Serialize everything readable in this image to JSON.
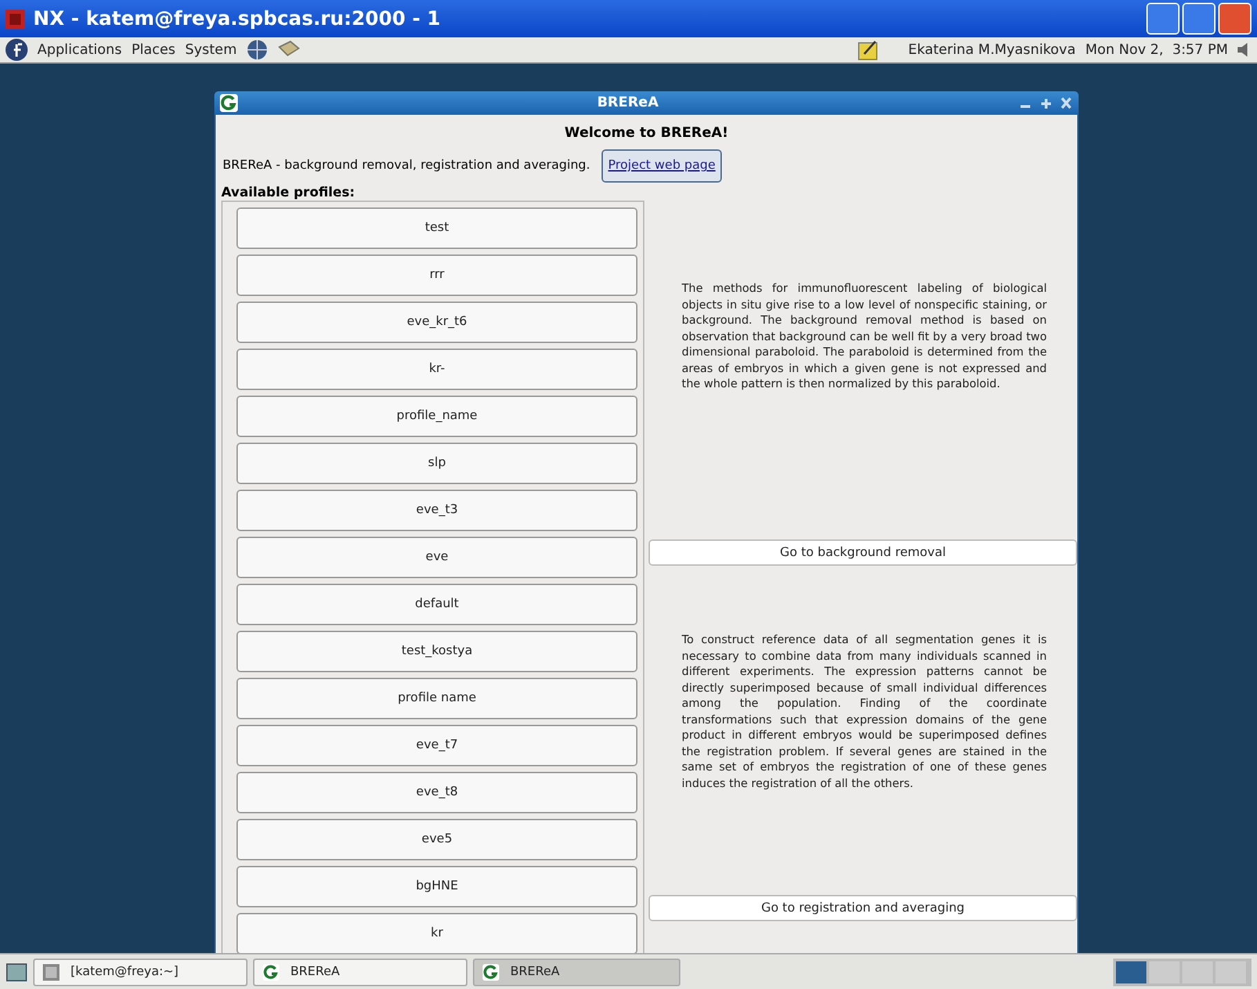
{
  "nx_window": {
    "title": "NX - katem@freya.spbcas.ru:2000 - 1"
  },
  "panel": {
    "menus": [
      "Applications",
      "Places",
      "System"
    ],
    "user": "Ekaterina M.Myasnikova",
    "clock": "Mon Nov 2,  3:57 PM"
  },
  "app_window": {
    "title": "BREReA",
    "heading": "Welcome to BREReA!",
    "description": "BREReA - background removal, registration and averaging.",
    "link": "Project web page",
    "profiles_label": "Available profiles:",
    "profiles": [
      "test",
      "rrr",
      "eve_kr_t6",
      "kr-",
      "profile_name",
      "slp",
      "eve_t3",
      "eve",
      "default",
      "test_kostya",
      "profile name",
      "eve_t7",
      "eve_t8",
      "eve5",
      "bgHNE",
      "kr"
    ],
    "sections": [
      {
        "text": "The methods for immunofluorescent labeling of biological objects in situ give rise to a low level of nonspecific staining, or background. The background removal method is based on observation that background can be well fit by a very broad two dimensional paraboloid. The paraboloid is determined from the areas of embryos in which a given gene is not expressed and the whole pattern is then normalized by this paraboloid.",
        "button": "Go to background removal"
      },
      {
        "text": "To construct reference data of all segmentation genes it is necessary to combine data from many individuals scanned in different experiments. The expression patterns cannot be directly superimposed because of small individual differences among the population. Finding of the coordinate transformations such that expression domains of the gene product in different embryos would be superimposed defines the registration problem. If several genes are stained in the same set of embryos the registration of one of these genes induces the registration of all the others.",
        "button": "Go to registration and averaging"
      }
    ]
  },
  "taskbar": {
    "items": [
      {
        "label": "[katem@freya:~]",
        "kind": "terminal",
        "selected": false
      },
      {
        "label": "BREReA",
        "kind": "app",
        "selected": false
      },
      {
        "label": "BREReA",
        "kind": "app",
        "selected": true
      }
    ]
  }
}
